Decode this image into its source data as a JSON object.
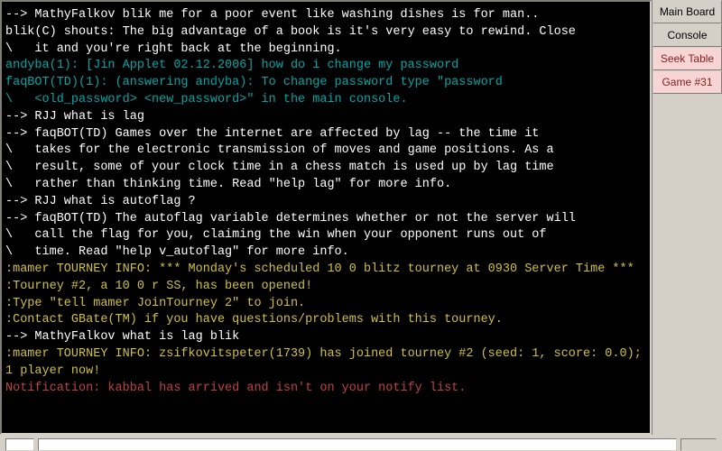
{
  "sidebar": {
    "tabs": [
      {
        "label": "Main Board",
        "hot": false
      },
      {
        "label": "Console",
        "hot": false
      },
      {
        "label": "Seek Table",
        "hot": true
      },
      {
        "label": "Game #31",
        "hot": true
      }
    ]
  },
  "input": {
    "value": "",
    "placeholder": ""
  },
  "console_lines": [
    {
      "color": "white",
      "text": ""
    },
    {
      "color": "white",
      "text": ""
    },
    {
      "color": "white",
      "text": "--> MathyFalkov blik me for a poor event like washing dishes is for man.."
    },
    {
      "color": "white",
      "text": "blik(C) shouts: The big advantage of a book is it's very easy to rewind. Close"
    },
    {
      "color": "white",
      "text": "\\   it and you're right back at the beginning."
    },
    {
      "color": "teal",
      "text": "andyba(1): [Jin Applet 02.12.2006] how do i change my password"
    },
    {
      "color": "teal",
      "text": "faqBOT(TD)(1): (answering andyba): To change password type \"password"
    },
    {
      "color": "teal",
      "text": "\\   <old_password> <new_password>\" in the main console."
    },
    {
      "color": "white",
      "text": "--> RJJ what is lag"
    },
    {
      "color": "white",
      "text": "--> faqBOT(TD) Games over the internet are affected by lag -- the time it"
    },
    {
      "color": "white",
      "text": "\\   takes for the electronic transmission of moves and game positions. As a"
    },
    {
      "color": "white",
      "text": "\\   result, some of your clock time in a chess match is used up by lag time"
    },
    {
      "color": "white",
      "text": "\\   rather than thinking time. Read \"help lag\" for more info."
    },
    {
      "color": "white",
      "text": "--> RJJ what is autoflag ?"
    },
    {
      "color": "white",
      "text": "--> faqBOT(TD) The autoflag variable determines whether or not the server will"
    },
    {
      "color": "white",
      "text": "\\   call the flag for you, claiming the win when your opponent runs out of"
    },
    {
      "color": "white",
      "text": "\\   time. Read \"help v_autoflag\" for more info."
    },
    {
      "color": "yellow",
      "text": ":mamer TOURNEY INFO: *** Monday's scheduled 10 0 blitz tourney at 0930 Server Time ***"
    },
    {
      "color": "yellow",
      "text": ":Tourney #2, a 10 0 r SS, has been opened!"
    },
    {
      "color": "yellow",
      "text": ":Type \"tell mamer JoinTourney 2\" to join."
    },
    {
      "color": "yellow",
      "text": ":Contact GBate(TM) if you have questions/problems with this tourney."
    },
    {
      "color": "white",
      "text": "--> MathyFalkov what is lag blik"
    },
    {
      "color": "yellow",
      "text": ":mamer TOURNEY INFO: zsifkovitspeter(1739) has joined tourney #2 (seed: 1, score: 0.0);"
    },
    {
      "color": "yellow",
      "text": "1 player now!"
    },
    {
      "color": "red",
      "text": "Notification: kabbal has arrived and isn't on your notify list."
    }
  ]
}
